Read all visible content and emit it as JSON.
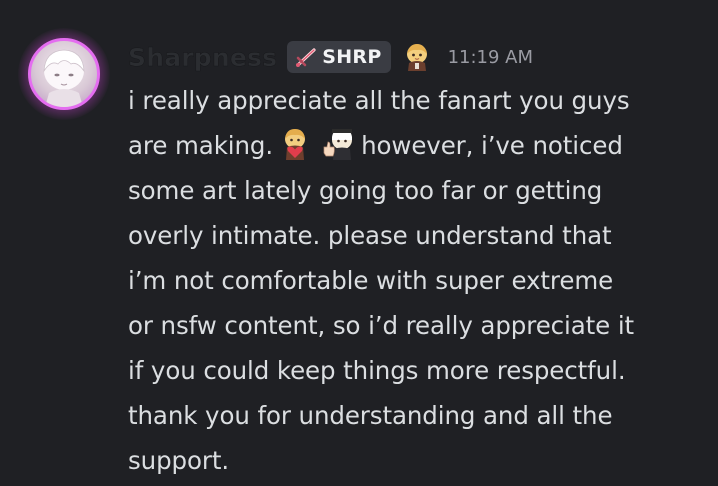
{
  "message": {
    "author": {
      "username": "Sharpness",
      "tag": "SHRP",
      "tag_icon": "sword-icon",
      "role_icon": "chibi-character-icon",
      "avatar": "avatar-white-hair-character"
    },
    "timestamp": "11:19 AM",
    "lines": {
      "l1": "i really appreciate all the fanart you guys",
      "l2a": "are making.",
      "l2b": "however, i’ve noticed",
      "l3": "some art lately going too far or getting",
      "l4": "overly intimate. please understand that",
      "l5": "i’m not comfortable with super extreme",
      "l6": "or nsfw content, so i’d really appreciate it",
      "l7": "if you could keep things more respectful.",
      "l8": "thank you for understanding and all the",
      "l9": "support."
    },
    "emojis": [
      "chibi-heart-emoji",
      "chibi-thumbs-up-emoji"
    ]
  },
  "colors": {
    "background": "#1f2024",
    "text": "#dbdee1",
    "timestamp": "#9a9ba3",
    "tag_background": "#3a3c43",
    "avatar_glow": "#e46df0"
  }
}
